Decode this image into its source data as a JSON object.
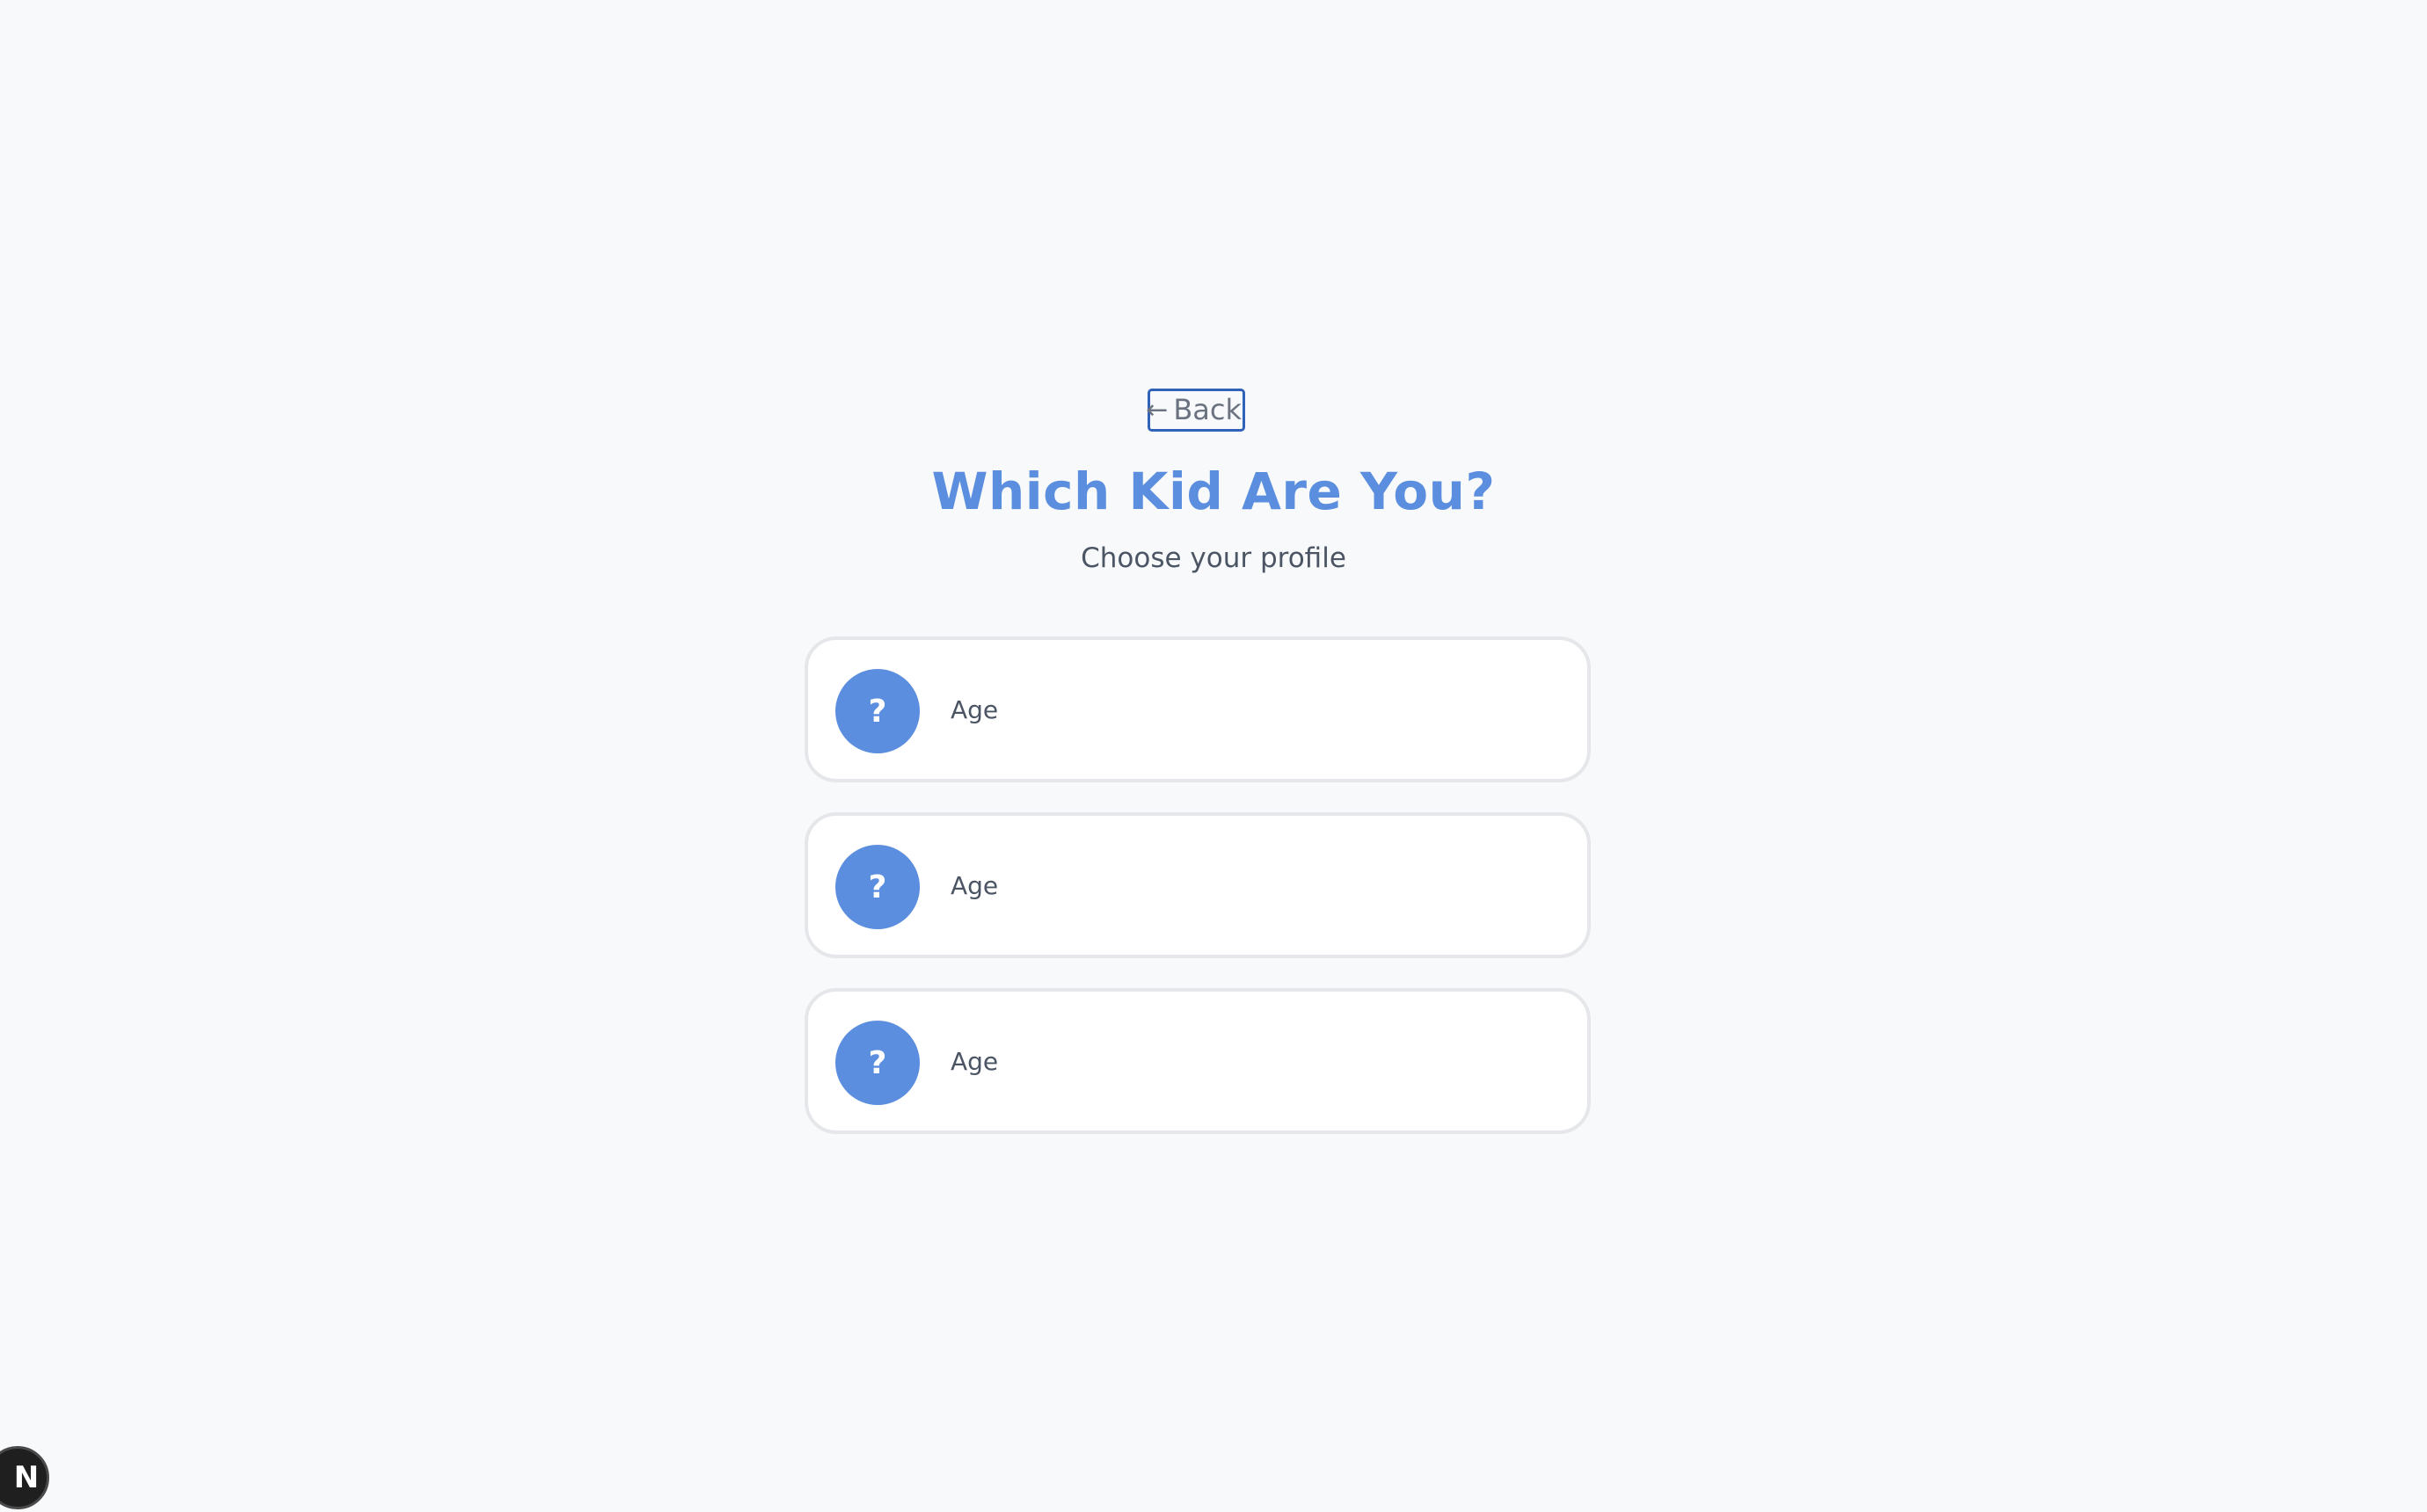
{
  "header": {
    "back_arrow": "←",
    "back_label": "Back",
    "title": "Which Kid Are You?",
    "subtitle": "Choose your profile"
  },
  "profiles": [
    {
      "avatar_glyph": "?",
      "label": "Age"
    },
    {
      "avatar_glyph": "?",
      "label": "Age"
    },
    {
      "avatar_glyph": "?",
      "label": "Age"
    }
  ],
  "dev_badge": {
    "letter": "N"
  },
  "colors": {
    "accent": "#5b8ede",
    "focus_ring": "#2f62b8",
    "background": "#f8f9fb",
    "card_border": "#e5e7eb",
    "text_muted": "#4b5563"
  }
}
